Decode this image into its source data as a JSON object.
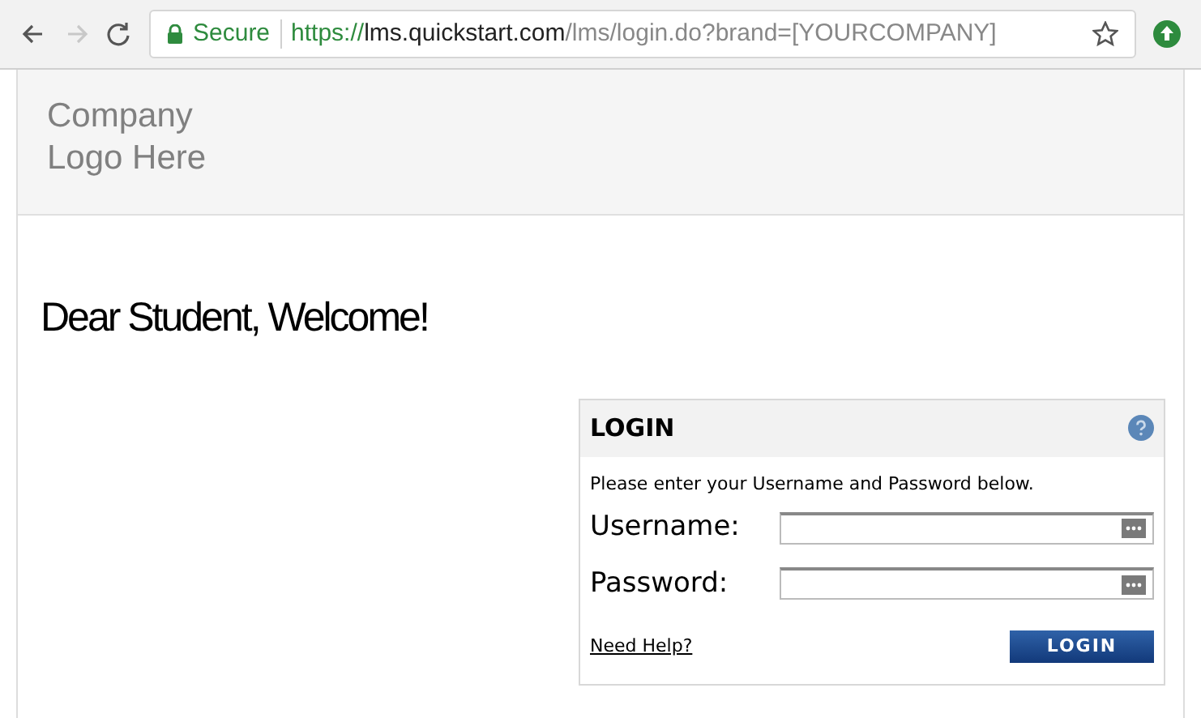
{
  "browser": {
    "nav_buttons": [
      {
        "kind": "back",
        "disabled": false
      },
      {
        "kind": "forward",
        "disabled": true
      },
      {
        "kind": "reload",
        "disabled": false
      }
    ],
    "security_label": "Secure",
    "url": {
      "scheme": "https://",
      "host": "lms.quickstart.com",
      "path": "/lms/login.do?brand=[YOURCOMPANY]"
    }
  },
  "header": {
    "logo_lines": [
      "Company",
      "Logo Here"
    ]
  },
  "welcome": "Dear Student, Welcome!",
  "login": {
    "title": "LOGIN",
    "instructions": "Please enter your Username and Password below.",
    "fields": [
      {
        "label": "Username:"
      },
      {
        "label": "Password:"
      }
    ],
    "help_link": "Need Help?",
    "button": "LOGIN"
  }
}
